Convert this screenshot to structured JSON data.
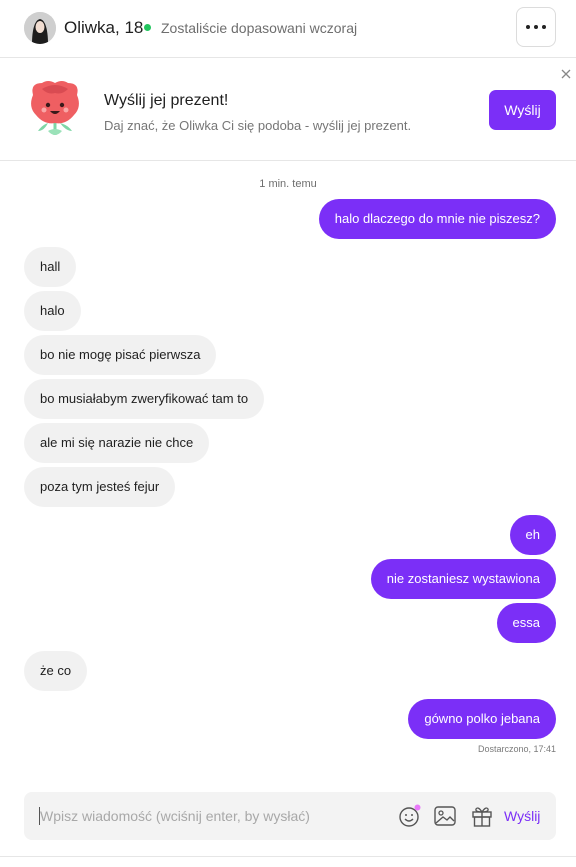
{
  "header": {
    "name": "Oliwka, 18",
    "status": "Zostaliście dopasowani wczoraj",
    "online_color": "#22c55e",
    "more_icon": "more-horizontal-icon"
  },
  "banner": {
    "title": "Wyślij jej prezent!",
    "subtitle": "Daj znać, że Oliwka Ci się podoba - wyślij jej prezent.",
    "send_label": "Wyślij",
    "illustration": "rose-mascot",
    "close_icon": "close-icon"
  },
  "chat": {
    "timestamp": "1 min. temu",
    "messages": [
      {
        "from": "me",
        "text": "halo dlaczego do mnie nie piszesz?"
      },
      {
        "from": "them",
        "text": "hall"
      },
      {
        "from": "them",
        "text": "halo"
      },
      {
        "from": "them",
        "text": "bo nie mogę pisać pierwsza"
      },
      {
        "from": "them",
        "text": "bo musiałabym zweryfikować tam to"
      },
      {
        "from": "them",
        "text": "ale mi się narazie nie chce"
      },
      {
        "from": "them",
        "text": "poza tym jesteś fejur"
      },
      {
        "from": "me",
        "text": "eh"
      },
      {
        "from": "me",
        "text": "nie zostaniesz wystawiona"
      },
      {
        "from": "me",
        "text": "essa"
      },
      {
        "from": "them",
        "text": "że co"
      },
      {
        "from": "me",
        "text": "gówno polko jebana"
      }
    ],
    "delivered": "Dostarczono, 17:41"
  },
  "composer": {
    "placeholder": "Wpisz wiadomość (wciśnij enter, by wysłać)",
    "value": "",
    "send_label": "Wyślij",
    "icons": [
      "emoji-icon",
      "image-icon",
      "gift-icon"
    ]
  },
  "colors": {
    "accent": "#7b2ff7",
    "incoming_bubble": "#f1f1f1"
  }
}
